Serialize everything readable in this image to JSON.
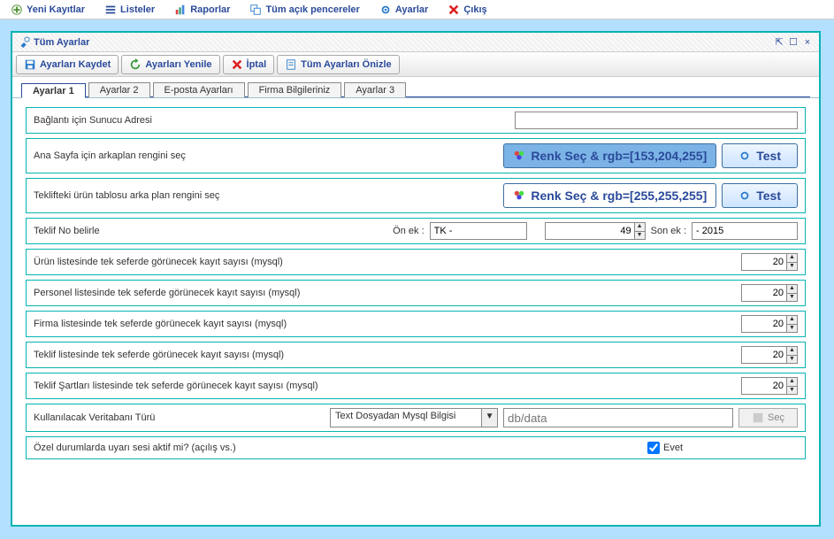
{
  "menu": {
    "new": "Yeni Kayıtlar",
    "lists": "Listeler",
    "reports": "Raporlar",
    "windows": "Tüm açık pencereler",
    "settings": "Ayarlar",
    "exit": "Çıkış"
  },
  "window": {
    "title": "Tüm Ayarlar"
  },
  "toolbar": {
    "save": "Ayarları Kaydet",
    "refresh": "Ayarları Yenile",
    "cancel": "İptal",
    "preview": "Tüm Ayarları Önizle"
  },
  "tabs": [
    "Ayarlar 1",
    "Ayarlar 2",
    "E-posta Ayarları",
    "Firma Bilgileriniz",
    "Ayarlar 3"
  ],
  "rows": {
    "conn": {
      "label": "Bağlantı için Sunucu Adresi",
      "value": ""
    },
    "bgcolor1": {
      "label": "Ana Sayfa için arkaplan rengini seç",
      "btn": "Renk Seç  &  rgb=[153,204,255]",
      "test": "Test"
    },
    "bgcolor2": {
      "label": "Teklifteki ürün tablosu arka plan rengini seç",
      "btn": "Renk Seç  &  rgb=[255,255,255]",
      "test": "Test"
    },
    "offerno": {
      "label": "Teklif No belirle",
      "prefix_lbl": "Ön ek :",
      "prefix_val": "TK -",
      "number": "49",
      "suffix_lbl": "Son ek :",
      "suffix_val": "- 2015"
    },
    "n_product": {
      "label": "Ürün listesinde tek seferde görünecek kayıt sayısı (mysql)",
      "val": "20"
    },
    "n_staff": {
      "label": "Personel listesinde tek seferde görünecek kayıt sayısı (mysql)",
      "val": "20"
    },
    "n_firm": {
      "label": "Firma listesinde tek seferde görünecek kayıt sayısı (mysql)",
      "val": "20"
    },
    "n_offer": {
      "label": "Teklif listesinde tek seferde görünecek kayıt sayısı (mysql)",
      "val": "20"
    },
    "n_terms": {
      "label": "Teklif Şartları listesinde tek seferde görünecek kayıt sayısı (mysql)",
      "val": "20"
    },
    "db": {
      "label": "Kullanılacak Veritabanı Türü",
      "combo": "Text Dosyadan Mysql Bilgisi",
      "placeholder": "db/data",
      "select": "Seç"
    },
    "sound": {
      "label": "Özel durumlarda uyarı sesi aktif mi? (açılış vs.)",
      "chk": "Evet"
    }
  }
}
